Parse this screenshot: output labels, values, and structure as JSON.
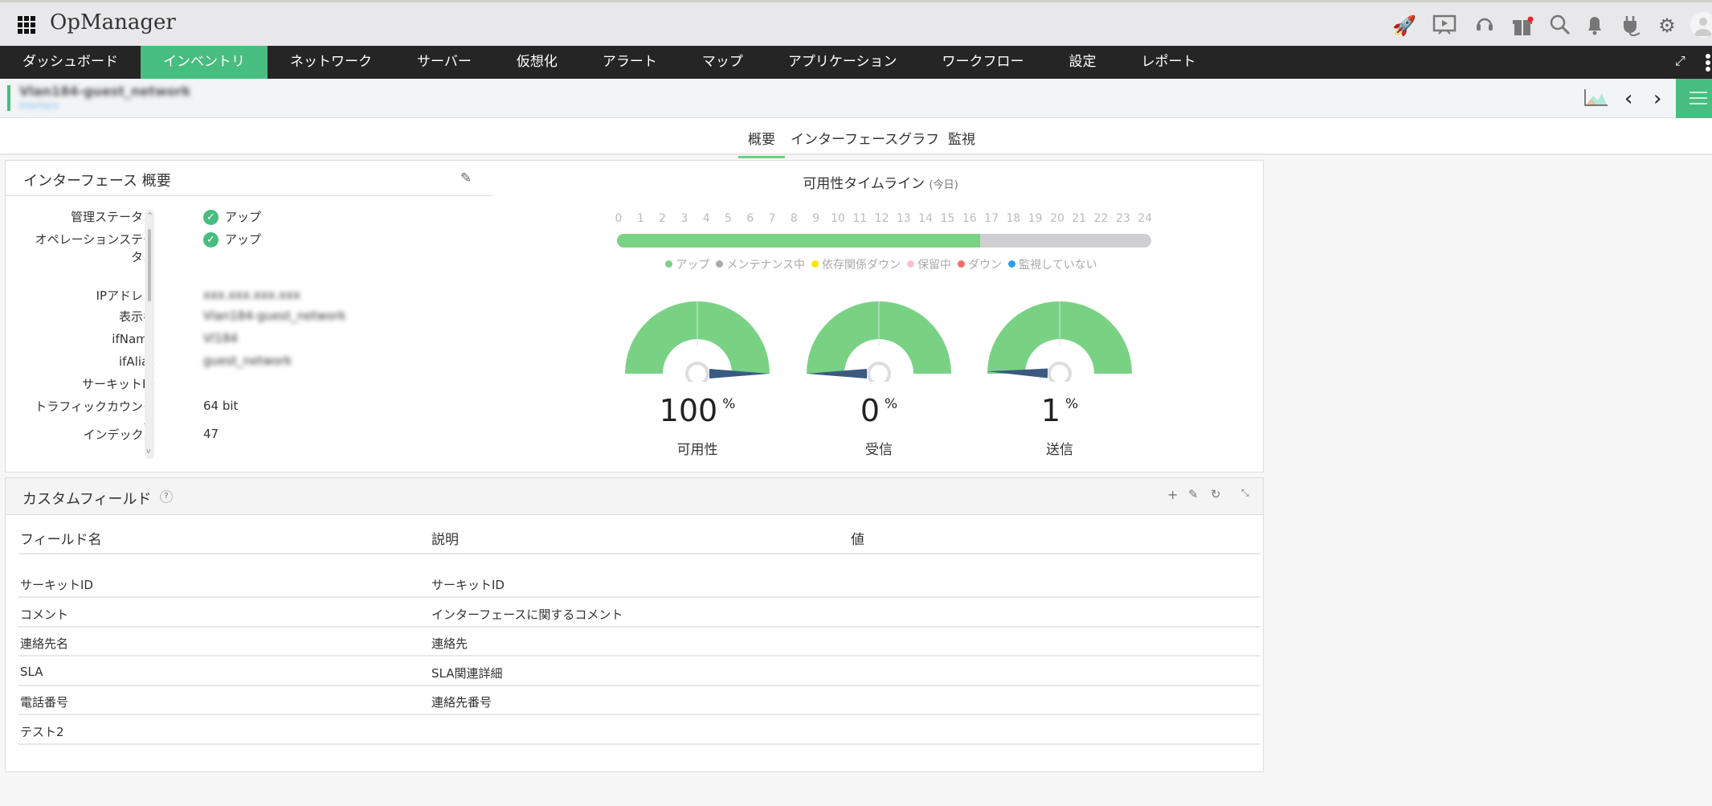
{
  "header": {
    "app_title": "OpManager",
    "icons": [
      "rocket-icon",
      "presentation-icon",
      "headset-icon",
      "gift-icon",
      "search-icon",
      "bell-icon",
      "plug-icon",
      "gear-icon",
      "avatar-icon"
    ]
  },
  "nav": {
    "items": [
      "ダッシュボード",
      "インベントリ",
      "ネットワーク",
      "サーバー",
      "仮想化",
      "アラート",
      "マップ",
      "アプリケーション",
      "ワークフロー",
      "設定",
      "レポート"
    ],
    "active": 1
  },
  "subheader": {
    "name": "Vlan184-guest_network",
    "link": "Interface"
  },
  "tabs": [
    {
      "label": "概要",
      "active": true
    },
    {
      "label": "インターフェースグラフ"
    },
    {
      "label": "監視"
    }
  ],
  "overview": {
    "title": "インターフェース 概要",
    "rows": [
      {
        "label": "管理ステータス",
        "value": "アップ",
        "status": "up"
      },
      {
        "label": "オペレーションステータス",
        "value": "アップ",
        "status": "up"
      },
      {
        "label": "IPアドレス",
        "value": "xxx.xxx.xxx.xxx",
        "blurred": true
      },
      {
        "label": "表示名",
        "value": "Vlan184-guest_network",
        "blurred": true
      },
      {
        "label": "ifName",
        "value": "Vl184",
        "blurred": true
      },
      {
        "label": "ifAlias",
        "value": "guest_network",
        "blurred": true
      },
      {
        "label": "サーキットID",
        "value": ""
      },
      {
        "label": "トラフィックカウンター",
        "value": "64 bit"
      },
      {
        "label": "インデックス",
        "value": "47"
      }
    ]
  },
  "timeline": {
    "title": "可用性タイムライン",
    "subtitle": "(今日)",
    "hours": [
      "0",
      "1",
      "2",
      "3",
      "4",
      "5",
      "6",
      "7",
      "8",
      "9",
      "10",
      "11",
      "12",
      "13",
      "14",
      "15",
      "16",
      "17",
      "18",
      "19",
      "20",
      "21",
      "22",
      "23",
      "24"
    ],
    "up_until_hour": 16.3,
    "colors": {
      "up": "#79d284",
      "rest": "#cfcfd1"
    },
    "legend": [
      {
        "label": "アップ",
        "color": "#79d284"
      },
      {
        "label": "メンテナンス中",
        "color": "#aaaaaa"
      },
      {
        "label": "依存関係ダウン",
        "color": "#ffe600"
      },
      {
        "label": "保留中",
        "color": "#ffc0cb"
      },
      {
        "label": "ダウン",
        "color": "#f26d6d"
      },
      {
        "label": "監視していない",
        "color": "#2e9ef0"
      }
    ]
  },
  "gauges": [
    {
      "value": "100",
      "unit": "%",
      "label": "可用性",
      "pct": 100
    },
    {
      "value": "0",
      "unit": "%",
      "label": "受信",
      "pct": 0
    },
    {
      "value": "1",
      "unit": "%",
      "label": "送信",
      "pct": 1
    }
  ],
  "custom_fields": {
    "title": "カスタムフィールド",
    "help": "?",
    "columns": [
      "フィールド名",
      "説明",
      "値"
    ],
    "rows": [
      [
        "サーキットID",
        "サーキットID",
        ""
      ],
      [
        "コメント",
        "インターフェースに関するコメント",
        ""
      ],
      [
        "連絡先名",
        "連絡先",
        ""
      ],
      [
        "SLA",
        "SLA関連詳細",
        ""
      ],
      [
        "電話番号",
        "連絡先番号",
        ""
      ],
      [
        "テスト2",
        "",
        ""
      ]
    ]
  }
}
